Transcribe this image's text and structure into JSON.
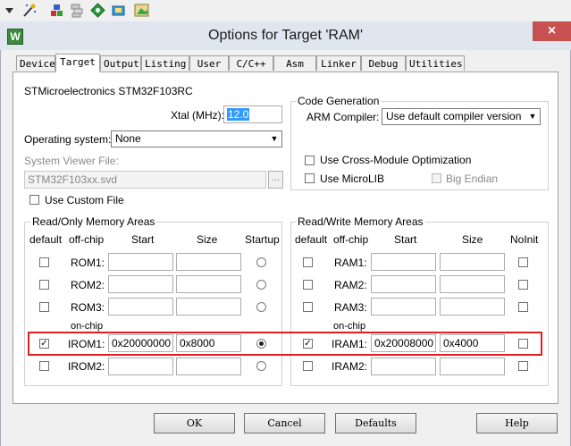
{
  "window": {
    "title": "Options for Target 'RAM'",
    "app_icon": "W",
    "close_label": "×"
  },
  "tabs": [
    "Device",
    "Target",
    "Output",
    "Listing",
    "User",
    "C/C++",
    "Asm",
    "Linker",
    "Debug",
    "Utilities"
  ],
  "target": {
    "device_name": "STMicroelectronics STM32F103RC",
    "xtal_label": "Xtal (MHz):",
    "xtal_value": "12.0",
    "os_label": "Operating system:",
    "os_value": "None",
    "svd_label": "System Viewer File:",
    "svd_value": "STM32F103xx.svd",
    "svd_browse": "...",
    "custom_file_label": "Use Custom File"
  },
  "codegen": {
    "title": "Code Generation",
    "arm_compiler_label": "ARM Compiler:",
    "arm_compiler_value": "Use default compiler version",
    "cross_module_label": "Use Cross-Module Optimization",
    "microlib_label": "Use MicroLIB",
    "big_endian_label": "Big Endian"
  },
  "rom": {
    "title": "Read/Only Memory Areas",
    "headers": {
      "default": "default",
      "offchip": "off-chip",
      "start": "Start",
      "size": "Size",
      "startup": "Startup"
    },
    "onchip_label": "on-chip",
    "rows": [
      {
        "name": "ROM1:",
        "start": "",
        "size": "",
        "default": false
      },
      {
        "name": "ROM2:",
        "start": "",
        "size": "",
        "default": false
      },
      {
        "name": "ROM3:",
        "start": "",
        "size": "",
        "default": false
      },
      {
        "name": "IROM1:",
        "start": "0x20000000",
        "size": "0x8000",
        "default": true
      },
      {
        "name": "IROM2:",
        "start": "",
        "size": "",
        "default": false
      }
    ]
  },
  "ram": {
    "title": "Read/Write Memory Areas",
    "headers": {
      "default": "default",
      "offchip": "off-chip",
      "start": "Start",
      "size": "Size",
      "noinit": "NoInit"
    },
    "onchip_label": "on-chip",
    "rows": [
      {
        "name": "RAM1:",
        "start": "",
        "size": "",
        "default": false
      },
      {
        "name": "RAM2:",
        "start": "",
        "size": "",
        "default": false
      },
      {
        "name": "RAM3:",
        "start": "",
        "size": "",
        "default": false
      },
      {
        "name": "IRAM1:",
        "start": "0x20008000",
        "size": "0x4000",
        "default": true
      },
      {
        "name": "IRAM2:",
        "start": "",
        "size": "",
        "default": false
      }
    ]
  },
  "buttons": {
    "ok": "OK",
    "cancel": "Cancel",
    "defaults": "Defaults",
    "help": "Help"
  },
  "colors": {
    "highlight": "#e0201e",
    "titlebar": "#dfe6ef",
    "close": "#c75050"
  }
}
